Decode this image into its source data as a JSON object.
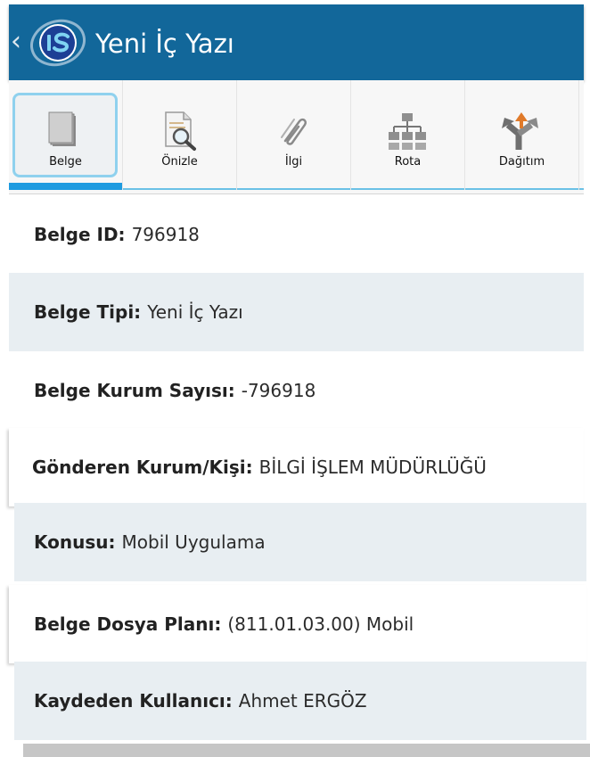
{
  "appbar": {
    "back_glyph": "‹",
    "logo_icon": "is-logo-icon",
    "title": "Yeni İç Yazı",
    "color": "#12679a"
  },
  "tabs": [
    {
      "label": "Belge",
      "icon": "document-stack-icon",
      "selected": true
    },
    {
      "label": "Önizle",
      "icon": "preview-magnifier-icon",
      "selected": false
    },
    {
      "label": "İlgi",
      "icon": "paperclip-icon",
      "selected": false
    },
    {
      "label": "Rota",
      "icon": "org-chart-icon",
      "selected": false
    },
    {
      "label": "Dağıtım",
      "icon": "split-arrow-icon",
      "selected": false
    }
  ],
  "fields": [
    {
      "label": "Belge ID:",
      "value": "796918"
    },
    {
      "label": "Belge Tipi:",
      "value": "Yeni İç Yazı"
    },
    {
      "label": "Belge Kurum Sayısı:",
      "value": "-796918"
    },
    {
      "label": "Gönderen Kurum/Kişi:",
      "value": "BİLGİ İŞLEM MÜDÜRLÜĞÜ"
    },
    {
      "label": "Konusu:",
      "value": "Mobil Uygulama"
    },
    {
      "label": "Belge Dosya Planı:",
      "value": "(811.01.03.00) Mobil"
    },
    {
      "label": "Kaydeden Kullanıcı:",
      "value": "Ahmet ERGÖZ"
    }
  ],
  "colors": {
    "accent_underline": "#1e9be0",
    "row_alt": "#e8eef2"
  }
}
